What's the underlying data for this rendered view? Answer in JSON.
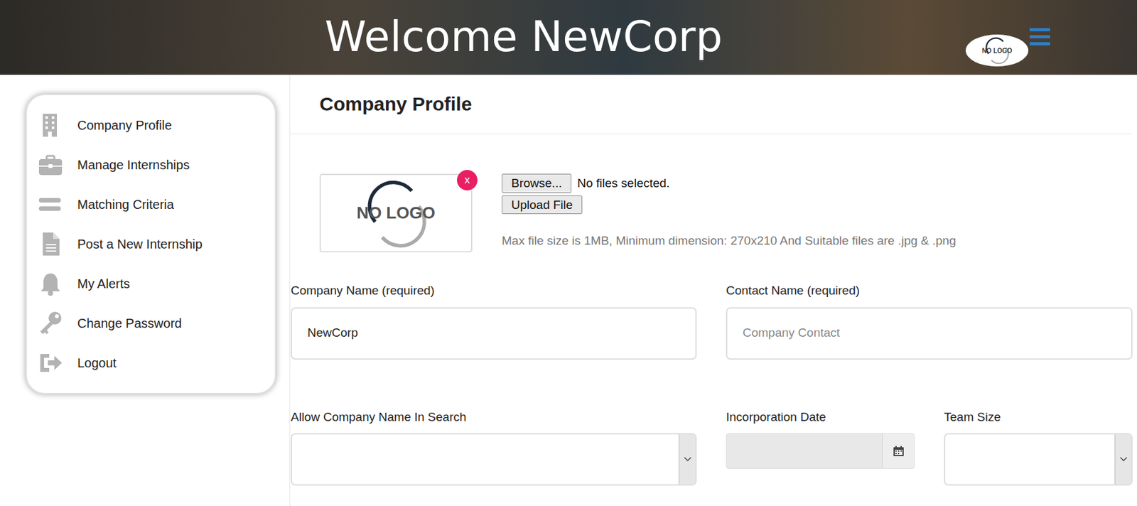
{
  "header": {
    "title": "Welcome NewCorp",
    "logo": "NO LOGO"
  },
  "sidebar": {
    "items": [
      {
        "label": "Company Profile"
      },
      {
        "label": "Manage Internships"
      },
      {
        "label": "Matching Criteria"
      },
      {
        "label": "Post a New Internship"
      },
      {
        "label": "My Alerts"
      },
      {
        "label": "Change Password"
      },
      {
        "label": "Logout"
      }
    ]
  },
  "page": {
    "title": "Company Profile"
  },
  "logo_upload": {
    "preview": "NO LOGO",
    "remove": "x",
    "browse": "Browse...",
    "file_status": "No files selected.",
    "upload": "Upload File",
    "hint": "Max file size is 1MB, Minimum dimension: 270x210 And Suitable files are .jpg & .png"
  },
  "fields": [
    {
      "label": "Company Name (required)",
      "kind": "text",
      "value": "NewCorp",
      "disabled": false
    },
    {
      "label": "Contact Name (required)",
      "kind": "text",
      "placeholder": "Company Contact",
      "disabled": false
    },
    {
      "label": "Allow Company Name In Search",
      "kind": "select",
      "disabled": false
    },
    {
      "label": "Incorporation Date",
      "kind": "date",
      "disabled": true
    },
    {
      "label": "Team Size",
      "kind": "select",
      "disabled": false
    }
  ]
}
